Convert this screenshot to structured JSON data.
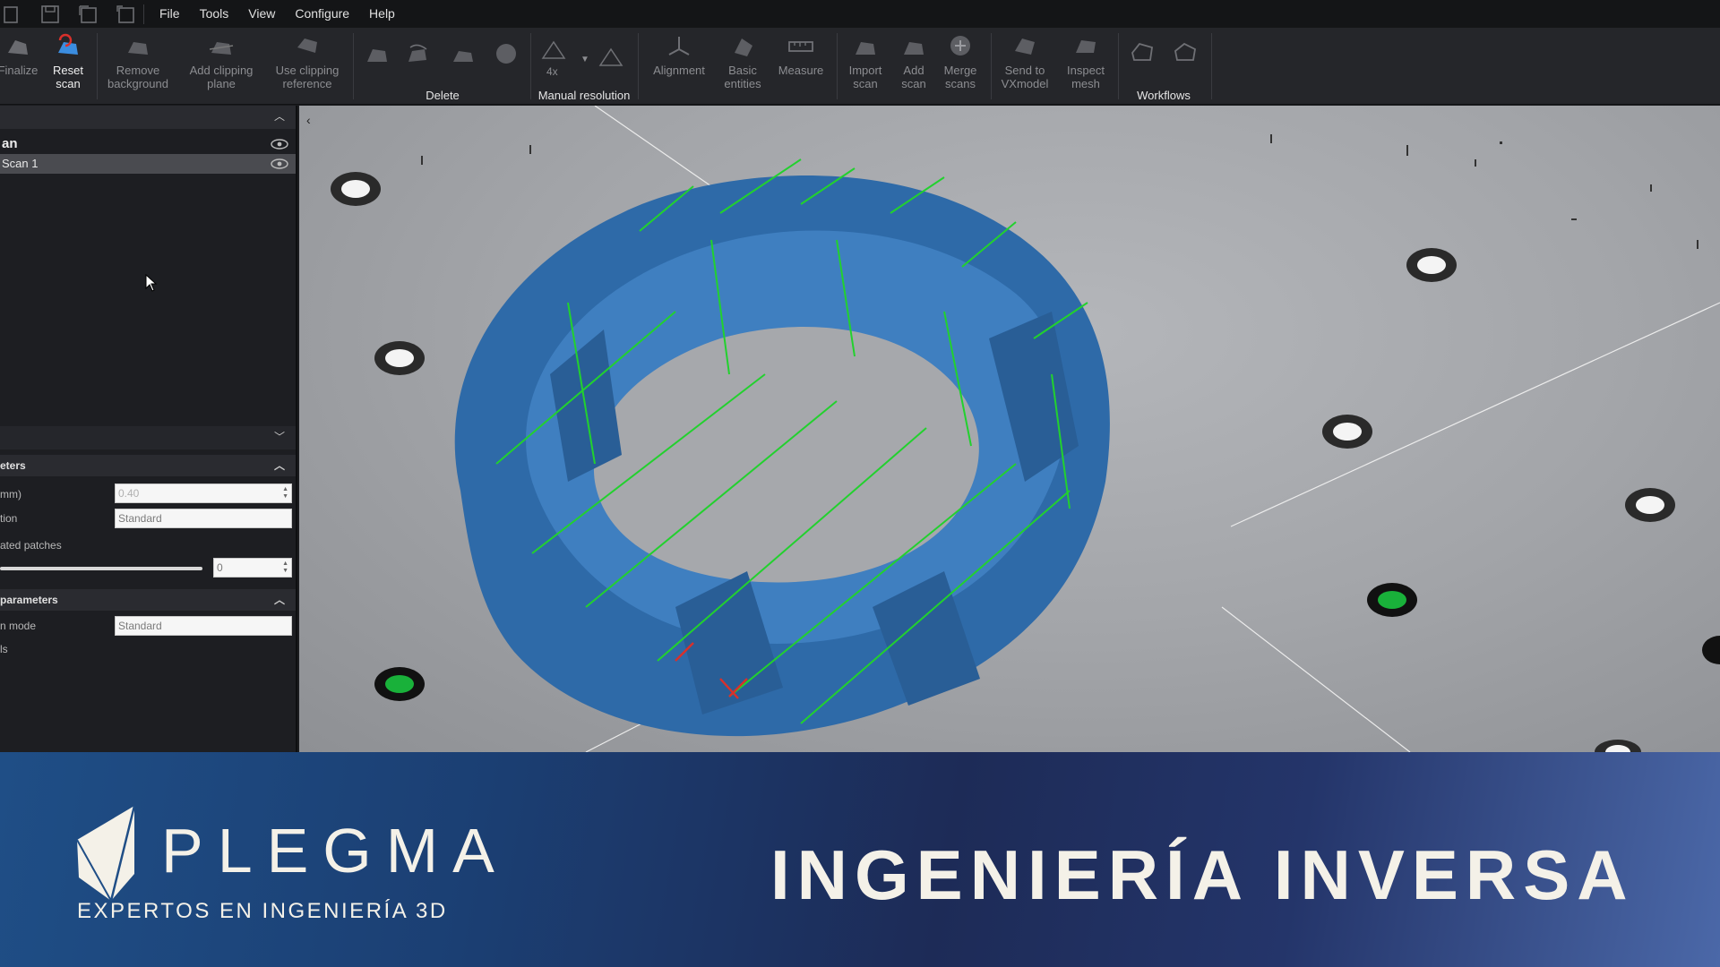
{
  "menu": {
    "items": [
      "File",
      "Tools",
      "View",
      "Configure",
      "Help"
    ]
  },
  "toolbar": {
    "finalize": "Finalize",
    "reset_scan": [
      "Reset",
      "scan"
    ],
    "remove_background": [
      "Remove",
      "background"
    ],
    "add_clipping_plane": [
      "Add clipping",
      "plane"
    ],
    "use_clipping_reference": [
      "Use clipping",
      "reference"
    ],
    "delete_group": "Delete",
    "resolution_value": "4x",
    "manual_resolution": "Manual resolution",
    "alignment": "Alignment",
    "basic_entities": [
      "Basic",
      "entities"
    ],
    "measure": "Measure",
    "import_scan": [
      "Import",
      "scan"
    ],
    "add_scan": [
      "Add",
      "scan"
    ],
    "merge_scans": [
      "Merge",
      "scans"
    ],
    "send_to_vxmodel": [
      "Send to",
      "VXmodel"
    ],
    "inspect_mesh": [
      "Inspect",
      "mesh"
    ],
    "workflows": "Workflows"
  },
  "tree": {
    "root_label": "an",
    "scan_label": "Scan 1"
  },
  "parameters": {
    "section1_title": "eters",
    "res_label": "mm)",
    "res_value": "0.40",
    "opt_label": "tion",
    "opt_value": "Standard",
    "patches_label": "ated patches",
    "patches_value": "0",
    "section2_title": "parameters",
    "mode_label": "n mode",
    "mode_value": "Standard",
    "extra_label": "ls"
  },
  "banner": {
    "brand": "PLEGMA",
    "tagline": "EXPERTOS EN INGENIERÍA 3D",
    "title": "INGENIERÍA INVERSA"
  },
  "colors": {
    "part_blue": "#3f7fc0",
    "banner_dark": "#1d2b57",
    "accent_red": "#d9302b",
    "target_green": "#19b13a"
  }
}
